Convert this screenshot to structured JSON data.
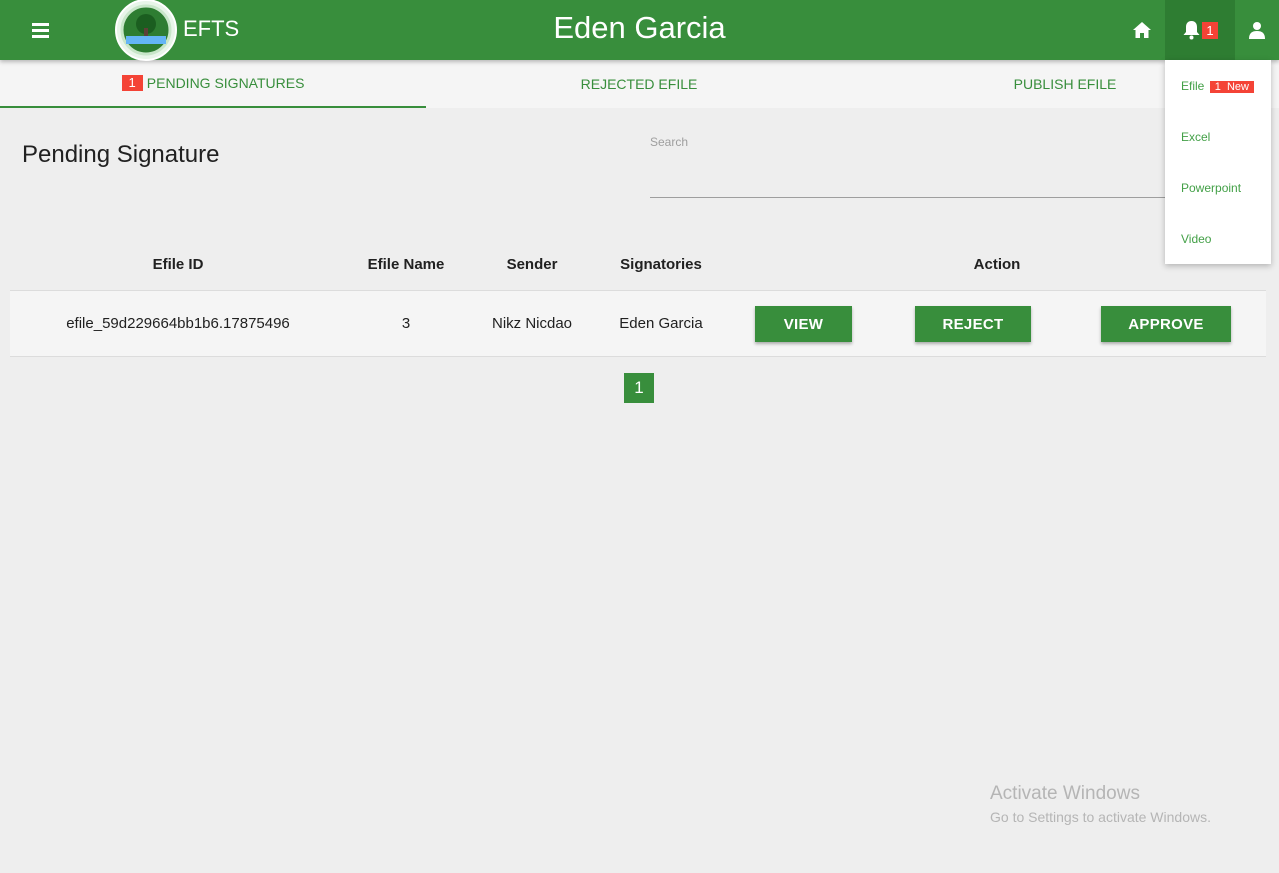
{
  "header": {
    "app_name": "EFTS",
    "user_name": "Eden Garcia",
    "notification_count": "1",
    "brand_color": "#388e3c"
  },
  "tabs": [
    {
      "label": "PENDING SIGNATURES",
      "badge": "1",
      "active": true
    },
    {
      "label": "REJECTED EFILE"
    },
    {
      "label": "PUBLISH EFILE"
    }
  ],
  "main": {
    "title": "Pending Signature",
    "search_label": "Search",
    "search_value": ""
  },
  "table": {
    "headers": [
      "Efile ID",
      "Efile Name",
      "Sender",
      "Signatories",
      "Action"
    ],
    "rows": [
      {
        "efile_id": "efile_59d229664bb1b6.17875496",
        "efile_name": "3",
        "sender": "Nikz Nicdao",
        "signatories": "Eden Garcia",
        "actions": [
          "VIEW",
          "REJECT",
          "APPROVE"
        ]
      }
    ]
  },
  "pagination": {
    "current_page": "1"
  },
  "notifications_menu": {
    "items": [
      {
        "label": "Efile",
        "count": "1",
        "tag": "New"
      },
      {
        "label": "Excel"
      },
      {
        "label": "Powerpoint"
      },
      {
        "label": "Video"
      }
    ]
  },
  "watermark": {
    "line1": "Activate Windows",
    "line2": "Go to Settings to activate Windows."
  },
  "icons": [
    "menu-icon",
    "logo-seal",
    "home-icon",
    "bell-icon",
    "user-icon"
  ]
}
